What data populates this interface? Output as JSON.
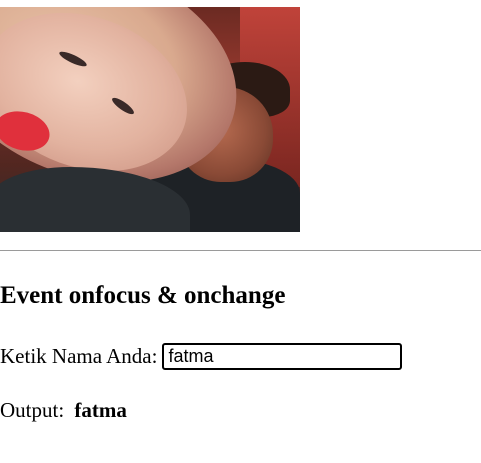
{
  "photo": {
    "description_icon": "photo-image"
  },
  "heading": "Event onfocus & onchange",
  "form": {
    "label": "Ketik Nama Anda:",
    "input_value": "fatma"
  },
  "output": {
    "label": "Output:",
    "value": "fatma"
  }
}
